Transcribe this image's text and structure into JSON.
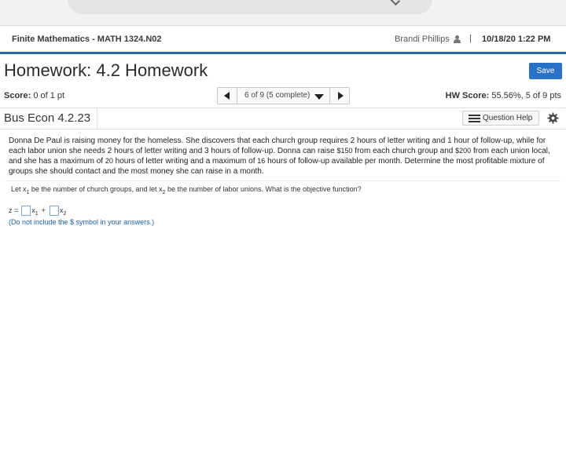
{
  "course": {
    "title": "Finite Mathematics - MATH 1324.N02",
    "user_name": "Brandi Phillips",
    "separator": "|",
    "datetime": "10/18/20 1:22 PM"
  },
  "homework": {
    "title": "Homework: 4.2 Homework",
    "save_label": "Save",
    "score_label": "Score:",
    "score_value": "0 of 1 pt",
    "nav_label": "6 of 9 (5 complete)",
    "hw_score_label": "HW Score:",
    "hw_score_value": "55.56%, 5 of 9 pts"
  },
  "problem": {
    "id": "Bus Econ 4.2.23",
    "help_label": "Question Help",
    "text_part1": "Donna De Paul is raising money for the homeless. She discovers that each church group requires 2 hours of letter writing and 1 hour of follow-up, while for each labor union she needs 2 hours of letter writing and 3 hours of follow-up. Donna can raise ",
    "amount_church": "$150",
    "text_part2": " from each church group and ",
    "amount_union": "$200",
    "text_part3": " from each union local, and she has a maximum of ",
    "max_letter": "20",
    "text_part4": " hours of letter writing and a maximum of ",
    "max_followup": "16",
    "text_part5": " hours of follow-up available per month. Determine the most profitable mixture of groups she should contact and the most money she can raise in a month.",
    "question_a": "Let x",
    "sub1": "1",
    "question_b": " be the number of church groups, and let x",
    "sub2": "2",
    "question_c": " be the number of labor unions. What is the objective function?",
    "z_label": "z =",
    "x_label": "x",
    "plus": "+",
    "note": "(Do not include the $ symbol in your answers.)"
  },
  "icons": {
    "user": "user-icon",
    "prev": "triangle-left-icon",
    "next": "triangle-right-icon",
    "dropdown": "triangle-down-icon",
    "help": "list-icon",
    "settings": "gear-icon"
  },
  "colors": {
    "accent": "#2a72c8",
    "header_rule": "#2a6aa8",
    "note": "#1a5fa8"
  }
}
